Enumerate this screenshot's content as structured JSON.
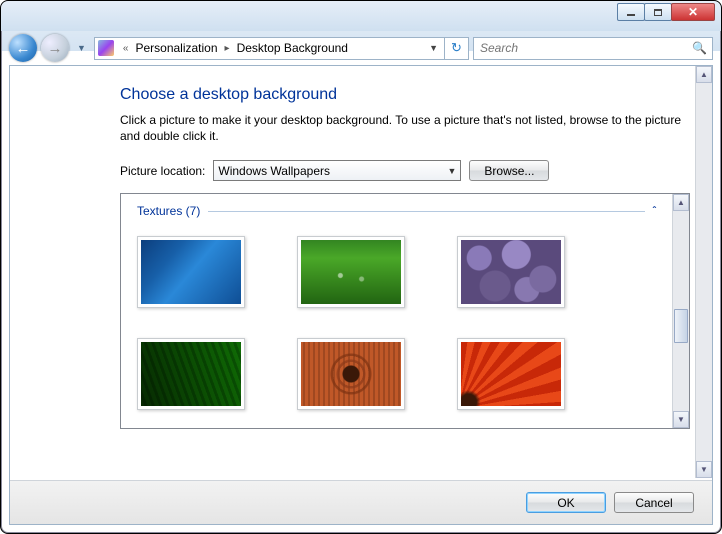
{
  "breadcrumb": {
    "item1": "Personalization",
    "item2": "Desktop Background"
  },
  "search": {
    "placeholder": "Search"
  },
  "page": {
    "heading": "Choose a desktop background",
    "description": "Click a picture to make it your desktop background. To use a picture that's not listed, browse to the picture and double click it.",
    "location_label": "Picture location:",
    "location_value": "Windows Wallpapers",
    "browse_label": "Browse..."
  },
  "group": {
    "title": "Textures (7)",
    "count": 7
  },
  "thumbs": {
    "t1": "fish-underwater",
    "t2": "green-grass",
    "t3": "purple-stones",
    "t4": "green-leaf",
    "t5": "wood-knot",
    "t6": "red-flower"
  },
  "footer": {
    "ok": "OK",
    "cancel": "Cancel"
  }
}
